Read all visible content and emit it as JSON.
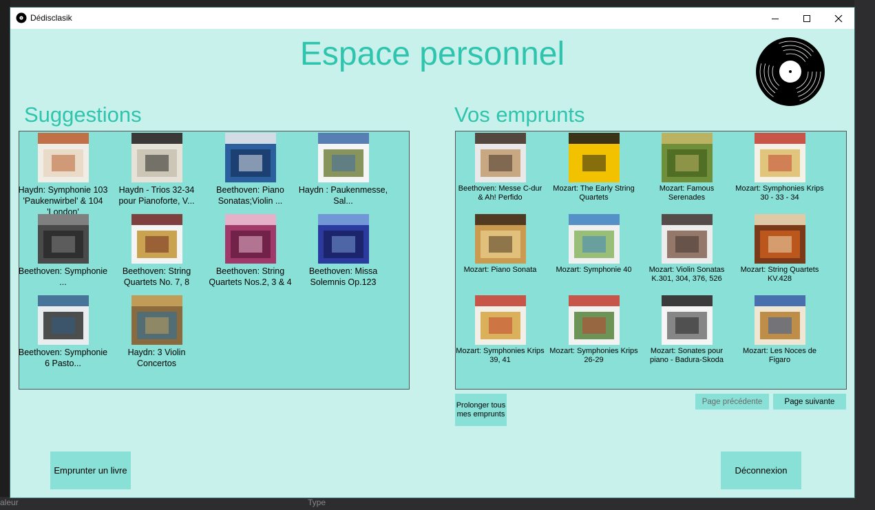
{
  "window": {
    "title": "Dédisclasik"
  },
  "page": {
    "heading": "Espace personnel"
  },
  "suggestions": {
    "title": "Suggestions",
    "items": [
      {
        "label": "Haydn: Symphonie 103 'Paukenwirbel' & 104 'London'",
        "cover": [
          "#f0ece6",
          "#b85a2a",
          "#e8d9c4"
        ]
      },
      {
        "label": "Haydn - Trios 32-34 pour Pianoforte, V...",
        "cover": [
          "#e6e2d8",
          "#1b1b1b",
          "#c9c3b4"
        ]
      },
      {
        "label": "Beethoven: Piano Sonatas;Violin ...",
        "cover": [
          "#2b5f9e",
          "#f1f1f1",
          "#1c3d6e"
        ]
      },
      {
        "label": "Haydn : Paukenmesse, Sal...",
        "cover": [
          "#f5f5f5",
          "#3b6aa8",
          "#7b8b4c"
        ]
      },
      {
        "label": "Beethoven: Symphonie ...",
        "cover": [
          "#4a4a4a",
          "#8a8a8a",
          "#2c2c2c"
        ]
      },
      {
        "label": "Beethoven: String Quartets No. 7, 8",
        "cover": [
          "#f4f4f4",
          "#6b1f1f",
          "#c49a3d"
        ]
      },
      {
        "label": "Beethoven: String Quartets Nos.2, 3 & 4",
        "cover": [
          "#a13a6b",
          "#f1c7d8",
          "#6d1f46"
        ]
      },
      {
        "label": "Beethoven: Missa Solemnis Op.123",
        "cover": [
          "#2a3a9e",
          "#7fa8e0",
          "#1b2466"
        ]
      },
      {
        "label": "Beethoven: Symphonie 6 Pasto...",
        "cover": [
          "#e9edf0",
          "#2d5e8a",
          "#3b3b3b"
        ]
      },
      {
        "label": "Haydn: 3 Violin Concertos",
        "cover": [
          "#8b6a3e",
          "#c9a45a",
          "#4c6e7a"
        ]
      }
    ]
  },
  "emprunts": {
    "title": "Vos emprunts",
    "items": [
      {
        "label": "Beethoven: Messe C-dur & Ah! Perfido",
        "cover": [
          "#e9e9e9",
          "#3a2a1e",
          "#c4a078"
        ]
      },
      {
        "label": "Mozart: The Early String Quartets",
        "cover": [
          "#f2c200",
          "#1a1a1a",
          "#f2c200"
        ]
      },
      {
        "label": "Mozart: Famous Serenades",
        "cover": [
          "#6f8f3a",
          "#c9b86a",
          "#4c6a22"
        ]
      },
      {
        "label": "Mozart: Symphonies Krips 30 - 33 - 34",
        "cover": [
          "#f4f1e6",
          "#c0392b",
          "#e0c070"
        ]
      },
      {
        "label": "Mozart: Piano Sonata",
        "cover": [
          "#c99a50",
          "#3b2a1a",
          "#e2c47f"
        ]
      },
      {
        "label": "Mozart: Symphonie 40",
        "cover": [
          "#f0f0f0",
          "#3a7fc0",
          "#8fb86a"
        ]
      },
      {
        "label": "Mozart: Violin Sonatas K.301, 304, 376, 526",
        "cover": [
          "#ededed",
          "#3a2e2a",
          "#8a6a5a"
        ]
      },
      {
        "label": "Mozart: String Quartets KV.428",
        "cover": [
          "#7a3a1a",
          "#f0e4c0",
          "#c25a1e"
        ]
      },
      {
        "label": "Mozart: Symphonies Krips 39, 41",
        "cover": [
          "#f2efe8",
          "#c0392b",
          "#d8a84a"
        ]
      },
      {
        "label": "Mozart: Symphonies Krips 26-29",
        "cover": [
          "#f2f2f2",
          "#c0392b",
          "#5e8a46"
        ]
      },
      {
        "label": "Mozart: Sonates pour piano - Badura-Skoda",
        "cover": [
          "#f5f5f5",
          "#1a1a1a",
          "#7a7a7a"
        ]
      },
      {
        "label": "Mozart: Les Noces de Figaro",
        "cover": [
          "#efe6d4",
          "#2a5aa8",
          "#b8843a"
        ]
      }
    ]
  },
  "buttons": {
    "prolonger": "Prolonger tous mes emprunts",
    "page_precedente": "Page précédente",
    "page_suivante": "Page suivante",
    "emprunter": "Emprunter un livre",
    "deconnexion": "Déconnexion"
  },
  "background_ide": {
    "value_col": "aleur",
    "type_col": "Type"
  },
  "colors": {
    "window_bg": "#c9f1ec",
    "panel_bg": "#88e0d6",
    "heading": "#2fc4ad"
  }
}
